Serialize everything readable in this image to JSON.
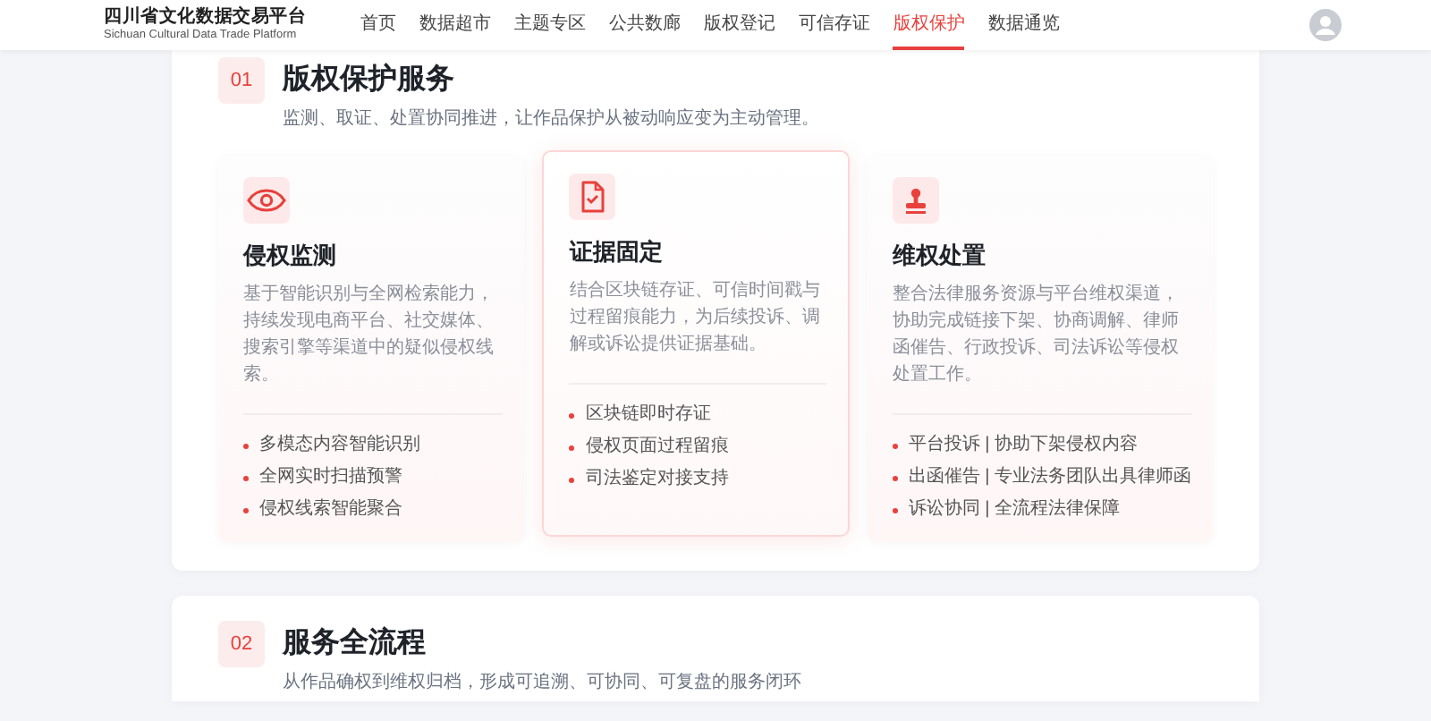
{
  "header": {
    "logo_title": "四川省文化数据交易平台",
    "logo_subtitle": "Sichuan Cultural Data Trade Platform",
    "nav": [
      {
        "label": "首页",
        "selected": false
      },
      {
        "label": "数据超市",
        "selected": false
      },
      {
        "label": "主题专区",
        "selected": false
      },
      {
        "label": "公共数廊",
        "selected": false
      },
      {
        "label": "版权登记",
        "selected": false
      },
      {
        "label": "可信存证",
        "selected": false
      },
      {
        "label": "版权保护",
        "selected": true
      },
      {
        "label": "数据通览",
        "selected": false
      }
    ]
  },
  "sections": [
    {
      "number": "01",
      "title": "版权保护服务",
      "subtitle": "监测、取证、处置协同推进，让作品保护从被动响应变为主动管理。",
      "cards": [
        {
          "title": "侵权监测",
          "description": "基于智能识别与全网检索能力，持续发现电商平台、社交媒体、搜索引擎等渠道中的疑似侵权线索。",
          "highlighted": false,
          "bullets": [
            "多模态内容智能识别",
            "全网实时扫描预警",
            "侵权线索智能聚合"
          ]
        },
        {
          "title": "证据固定",
          "description": "结合区块链存证、可信时间戳与过程留痕能力，为后续投诉、调解或诉讼提供证据基础。",
          "highlighted": true,
          "bullets": [
            "区块链即时存证",
            "侵权页面过程留痕",
            "司法鉴定对接支持"
          ]
        },
        {
          "title": "维权处置",
          "description": "整合法律服务资源与平台维权渠道，协助完成链接下架、协商调解、律师函催告、行政投诉、司法诉讼等侵权处置工作。",
          "highlighted": false,
          "bullets": [
            "平台投诉 | 协助下架侵权内容",
            "出函催告 | 专业法务团队出具律师函",
            "诉讼协同 | 全流程法律保障"
          ]
        }
      ]
    },
    {
      "number": "02",
      "title": "服务全流程",
      "subtitle": "从作品确权到维权归档，形成可追溯、可协同、可复盘的服务闭环"
    }
  ]
}
